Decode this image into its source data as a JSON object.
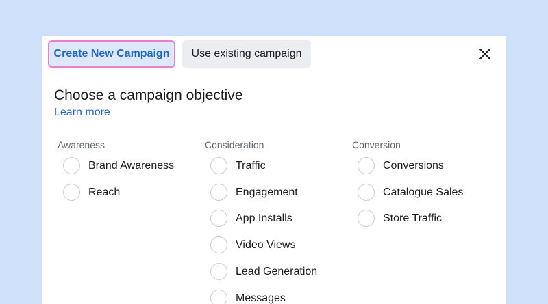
{
  "tabs": {
    "create_label": "Create New Campaign",
    "existing_label": "Use existing campaign"
  },
  "close_icon": "close-icon",
  "heading": "Choose a campaign objective",
  "learn_more": "Learn more",
  "columns": {
    "awareness": {
      "title": "Awareness",
      "options": [
        "Brand Awareness",
        "Reach"
      ]
    },
    "consideration": {
      "title": "Consideration",
      "options": [
        "Traffic",
        "Engagement",
        "App Installs",
        "Video Views",
        "Lead Generation",
        "Messages"
      ]
    },
    "conversion": {
      "title": "Conversion",
      "options": [
        "Conversions",
        "Catalogue Sales",
        "Store Traffic"
      ]
    }
  },
  "colors": {
    "background": "#cfe0fb",
    "accent": "#1d66d6",
    "selected_tab_border": "#ec7fcd"
  }
}
